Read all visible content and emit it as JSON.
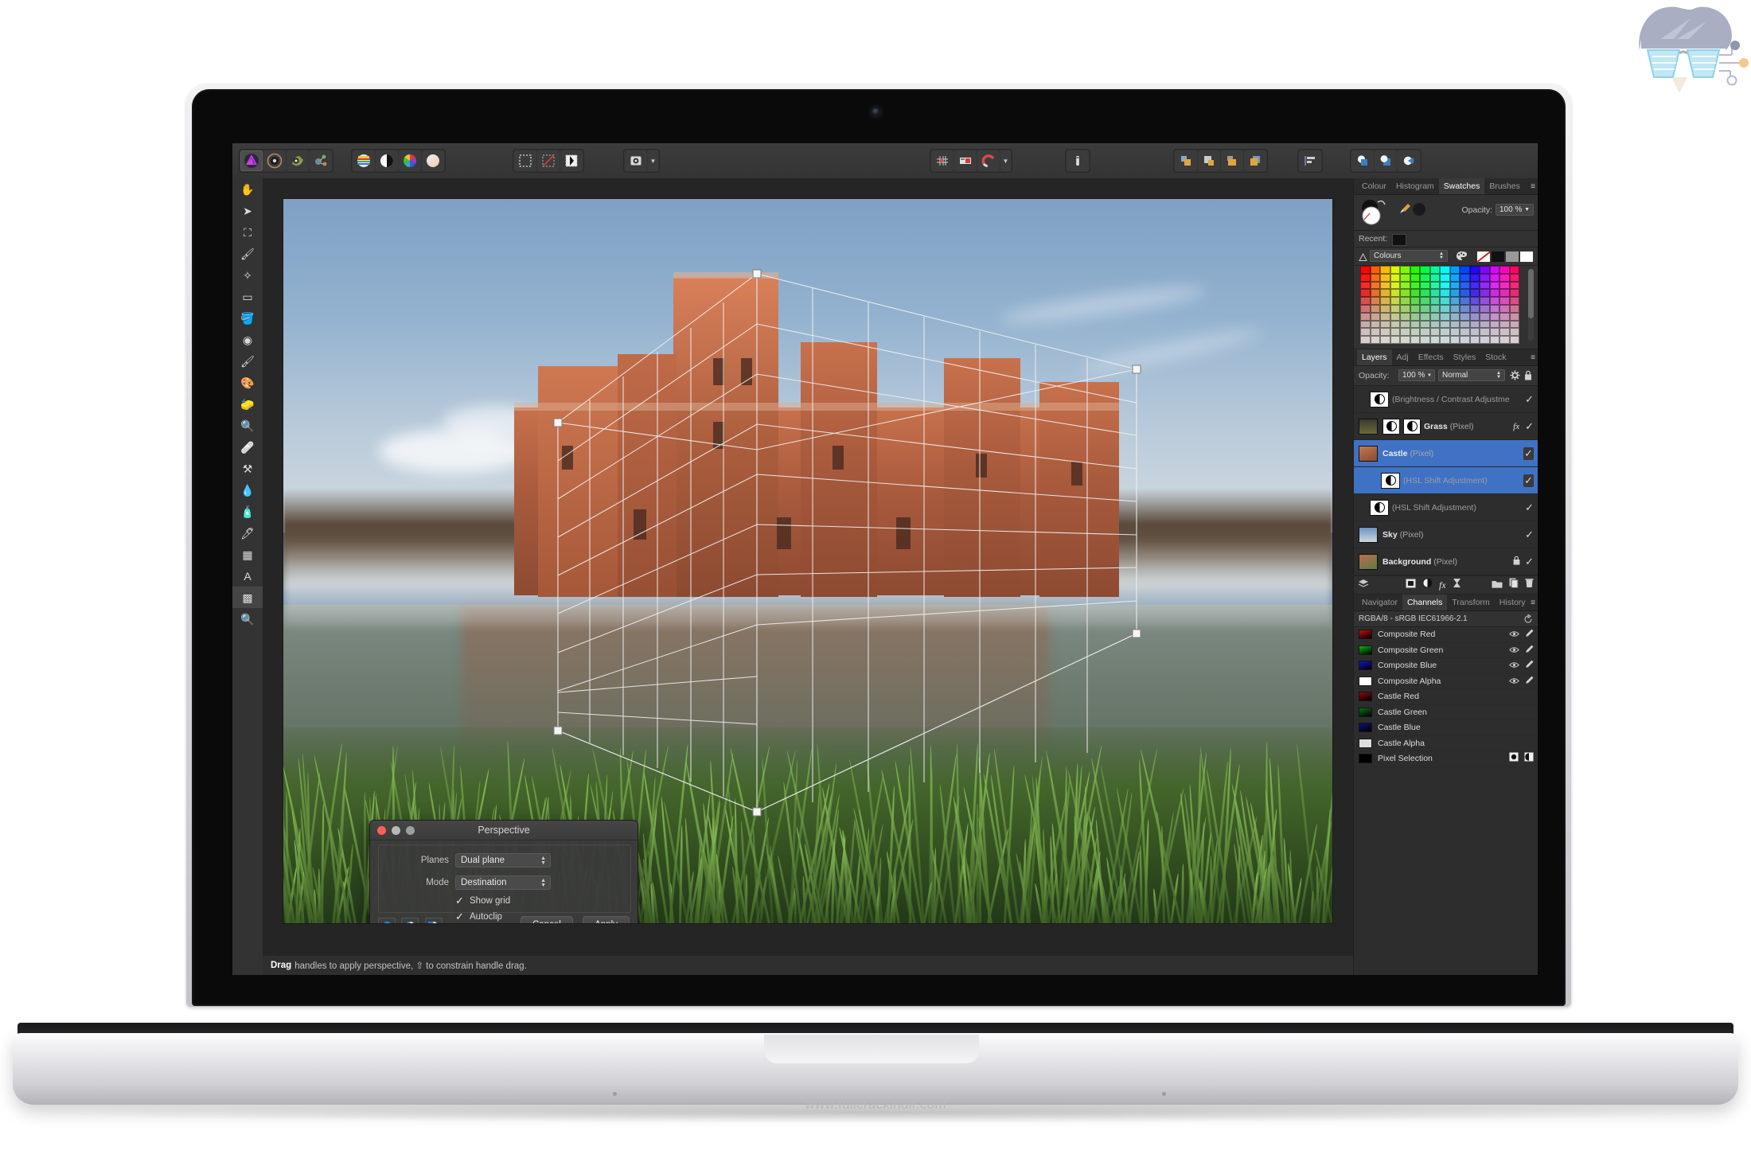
{
  "brand": {
    "watermark": "www.fullcrackindir.com",
    "logo_name": "circuit-glasses-logo"
  },
  "app": {
    "name": "Affinity Photo",
    "toolbar": {
      "left_group": [
        {
          "name": "affinity-photo-persona",
          "label": "Photo Persona",
          "selected": true
        },
        {
          "name": "liquify-persona",
          "label": "Liquify Persona",
          "selected": false
        },
        {
          "name": "develop-persona",
          "label": "Develop Persona",
          "selected": false
        },
        {
          "name": "export-persona",
          "label": "Export Persona",
          "selected": false
        }
      ],
      "adjust_group": [
        {
          "name": "levels-icon",
          "label": "Levels"
        },
        {
          "name": "contrast-icon",
          "label": "Brightness / Contrast"
        },
        {
          "name": "colour-wheel-icon",
          "label": "Colour Balance"
        },
        {
          "name": "white-balance-icon",
          "label": "White Balance"
        }
      ],
      "select_group": [
        {
          "name": "select-all-icon",
          "label": "Select All"
        },
        {
          "name": "deselect-icon",
          "label": "Deselect"
        },
        {
          "name": "invert-selection-icon",
          "label": "Invert Pixel Selection"
        }
      ],
      "refine_group": [
        {
          "name": "refine-selection-icon",
          "label": "Refine Selection",
          "has_caret": true
        }
      ],
      "snapping_group": [
        {
          "name": "show-grid-icon",
          "label": "Show Grid"
        },
        {
          "name": "guides-icon",
          "label": "Show Guides"
        },
        {
          "name": "snapping-magnet-icon",
          "label": "Enable Snapping",
          "has_caret": true
        }
      ],
      "assistant_group": [
        {
          "name": "assistant-icon",
          "label": "Assistant Manager"
        }
      ],
      "arrange_group": [
        {
          "name": "move-to-front-icon",
          "label": "Move to Front"
        },
        {
          "name": "move-forward-icon",
          "label": "Move Forward One"
        },
        {
          "name": "move-back-icon",
          "label": "Move Back One"
        },
        {
          "name": "move-to-back-icon",
          "label": "Move to Back"
        }
      ],
      "align_group": [
        {
          "name": "alignment-icon",
          "label": "Alignment"
        }
      ],
      "boolean_group": [
        {
          "name": "add-geometry-icon",
          "label": "Add"
        },
        {
          "name": "subtract-geometry-icon",
          "label": "Subtract"
        },
        {
          "name": "intersect-geometry-icon",
          "label": "Intersect"
        }
      ]
    },
    "tools": [
      {
        "name": "view-tool",
        "label": "View Tool",
        "glyph": "✋",
        "selected": false
      },
      {
        "name": "move-tool",
        "label": "Move Tool",
        "glyph": "➤",
        "selected": false
      },
      {
        "name": "crop-tool",
        "label": "Crop Tool",
        "glyph": "⛶",
        "selected": false
      },
      {
        "name": "selection-brush-tool",
        "label": "Selection Brush Tool",
        "glyph": "🖌",
        "selected": false
      },
      {
        "name": "flood-select-tool",
        "label": "Flood Select Tool",
        "glyph": "✧",
        "selected": false
      },
      {
        "name": "marquee-tool",
        "label": "Rectangular Marquee Tool",
        "glyph": "▭",
        "selected": false
      },
      {
        "name": "flood-fill-tool",
        "label": "Flood Fill Tool",
        "glyph": "🪣",
        "selected": false
      },
      {
        "name": "gradient-tool",
        "label": "Gradient Tool",
        "glyph": "◉",
        "selected": false
      },
      {
        "name": "paint-brush-tool",
        "label": "Paint Brush Tool",
        "glyph": "🖌",
        "selected": false
      },
      {
        "name": "paint-mixer-tool",
        "label": "Paint Mixer Brush Tool",
        "glyph": "🎨",
        "selected": false
      },
      {
        "name": "erase-brush-tool",
        "label": "Erase Brush Tool",
        "glyph": "🧽",
        "selected": false
      },
      {
        "name": "dodge-brush-tool",
        "label": "Dodge Brush Tool",
        "glyph": "🔍",
        "selected": false
      },
      {
        "name": "blemish-removal-tool",
        "label": "Blemish Removal Tool",
        "glyph": "🩹",
        "selected": false
      },
      {
        "name": "clone-brush-tool",
        "label": "Clone Brush Tool",
        "glyph": "⚒",
        "selected": false
      },
      {
        "name": "smudge-tool",
        "label": "Smudge Brush Tool",
        "glyph": "💧",
        "selected": false
      },
      {
        "name": "sponge-tool",
        "label": "Sponge Brush Tool",
        "glyph": "🧴",
        "selected": false
      },
      {
        "name": "pen-tool",
        "label": "Pen Tool",
        "glyph": "🖊",
        "selected": false
      },
      {
        "name": "rectangle-tool",
        "label": "Rectangle Tool",
        "glyph": "▦",
        "selected": false
      },
      {
        "name": "artistic-text-tool",
        "label": "Artistic Text Tool",
        "glyph": "A",
        "selected": false
      },
      {
        "name": "perspective-tool",
        "label": "Perspective Tool",
        "glyph": "▩",
        "selected": true
      },
      {
        "name": "zoom-tool",
        "label": "Zoom Tool",
        "glyph": "🔍",
        "selected": false
      }
    ],
    "statusbar": {
      "bold": "Drag",
      "text": "handles to apply perspective, ⇧ to constrain handle drag."
    }
  },
  "dialog": {
    "title": "Perspective",
    "window_buttons": [
      "close",
      "minimise",
      "zoom"
    ],
    "fields": [
      {
        "label": "Planes",
        "value": "Dual plane",
        "name": "planes-select"
      },
      {
        "label": "Mode",
        "value": "Destination",
        "name": "mode-select"
      }
    ],
    "checkboxes": [
      {
        "label": "Show grid",
        "checked": true,
        "name": "show-grid-checkbox"
      },
      {
        "label": "Autoclip",
        "checked": true,
        "name": "autoclip-checkbox"
      }
    ],
    "mode_buttons": [
      {
        "name": "preview-full-button",
        "label": "Full preview",
        "selected": true
      },
      {
        "name": "preview-split-button",
        "label": "Split preview",
        "selected": false
      },
      {
        "name": "preview-mirror-button",
        "label": "Mirrored split preview",
        "selected": false
      }
    ],
    "cancel_label": "Cancel",
    "apply_label": "Apply"
  },
  "panels": {
    "colour_group": {
      "tabs": [
        {
          "label": "Colour",
          "active": false
        },
        {
          "label": "Histogram",
          "active": false
        },
        {
          "label": "Swatches",
          "active": true
        },
        {
          "label": "Brushes",
          "active": false
        }
      ],
      "opacity_label": "Opacity:",
      "opacity_value": "100 %",
      "recent_label": "Recent:",
      "palette_name": "Colours",
      "fill_mode_icons": [
        "no-fill-icon",
        "black-swatch-icon",
        "grey-swatch-icon",
        "white-swatch-icon"
      ]
    },
    "layers_group": {
      "tabs": [
        {
          "label": "Layers",
          "active": true
        },
        {
          "label": "Adj",
          "active": false
        },
        {
          "label": "Effects",
          "active": false
        },
        {
          "label": "Styles",
          "active": false
        },
        {
          "label": "Stock",
          "active": false
        }
      ],
      "opacity_label": "Opacity:",
      "opacity_value": "100 %",
      "blend_mode": "Normal",
      "rows": [
        {
          "name": "Brightness / Contrast Adjustme",
          "kind": "",
          "display": "(Brightness / Contrast Adjustme",
          "dim": true,
          "indent": 14,
          "thumb": "mask",
          "selected": false,
          "checked": true,
          "fx": false,
          "locked": false
        },
        {
          "name": "Grass",
          "kind": "(Pixel)",
          "display": "Grass",
          "dim": false,
          "indent": 0,
          "thumb": "grass",
          "selected": false,
          "checked": true,
          "fx": true,
          "locked": false,
          "extra_masks": 2
        },
        {
          "name": "Castle",
          "kind": "(Pixel)",
          "display": "Castle",
          "dim": false,
          "indent": 0,
          "thumb": "castle",
          "selected": true,
          "checked": true,
          "fx": false,
          "locked": false
        },
        {
          "name": "HSL Shift Adjustment",
          "kind": "",
          "display": "(HSL Shift Adjustment)",
          "dim": true,
          "indent": 28,
          "thumb": "mask",
          "selected": true,
          "checked": true,
          "fx": false,
          "locked": false
        },
        {
          "name": "HSL Shift Adjustment",
          "kind": "",
          "display": "(HSL Shift Adjustment)",
          "dim": true,
          "indent": 14,
          "thumb": "mask",
          "selected": false,
          "checked": true,
          "fx": false,
          "locked": false
        },
        {
          "name": "Sky",
          "kind": "(Pixel)",
          "display": "Sky",
          "dim": false,
          "indent": 0,
          "thumb": "sky",
          "selected": false,
          "checked": true,
          "fx": false,
          "locked": false
        },
        {
          "name": "Background",
          "kind": "(Pixel)",
          "display": "Background",
          "dim": false,
          "indent": 0,
          "thumb": "bg",
          "selected": false,
          "checked": true,
          "fx": false,
          "locked": true
        }
      ],
      "footer_icons": [
        "layer-stack-icon",
        "mask-layer-icon",
        "adjustment-layer-icon",
        "live-filter-icon",
        "hourglass-icon",
        "group-layer-icon",
        "duplicate-layer-icon",
        "delete-layer-icon"
      ]
    },
    "channels_group": {
      "tabs": [
        {
          "label": "Navigator",
          "active": false
        },
        {
          "label": "Channels",
          "active": true
        },
        {
          "label": "Transform",
          "active": false
        },
        {
          "label": "History",
          "active": false
        }
      ],
      "colour_profile": "RGBA/8 - sRGB IEC61966-2.1",
      "reset_icon": "reset-icon",
      "rows": [
        {
          "label": "Composite Red",
          "colour": "#c40d0d",
          "has_icons": true
        },
        {
          "label": "Composite Green",
          "colour": "#0cb40c",
          "has_icons": true
        },
        {
          "label": "Composite Blue",
          "colour": "#1212c8",
          "has_icons": true
        },
        {
          "label": "Composite Alpha",
          "colour": "#ffffff",
          "has_icons": true
        },
        {
          "label": "Castle Red",
          "colour": "#8c0a0a",
          "has_icons": false
        },
        {
          "label": "Castle Green",
          "colour": "#0a6e14",
          "has_icons": false
        },
        {
          "label": "Castle Blue",
          "colour": "#10107a",
          "has_icons": false
        },
        {
          "label": "Castle Alpha",
          "colour": "#dedede",
          "has_icons": false
        },
        {
          "label": "Pixel Selection",
          "colour": "#000000",
          "has_icons": false,
          "sel_icons": true
        }
      ]
    }
  }
}
